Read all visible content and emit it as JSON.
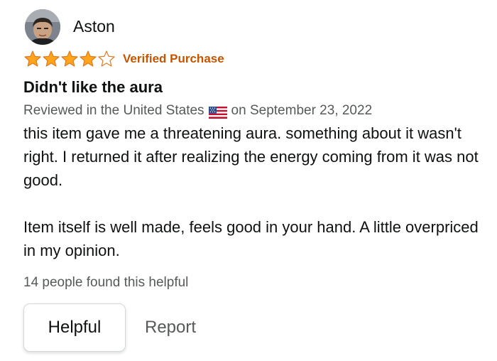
{
  "review": {
    "author": "Aston",
    "rating": 4,
    "rating_max": 5,
    "star_color": "#ffa41c",
    "verified_label": "Verified Purchase",
    "verified_color": "#c45500",
    "title": "Didn't like the aura",
    "meta_prefix": "Reviewed in the United States",
    "meta_flag_icon": "us-flag-icon",
    "meta_suffix": "on September 23, 2022",
    "body_paragraph_1": "this item gave me a threatening aura. something about it wasn't right. I returned it after realizing the energy coming from it was not good.",
    "body_paragraph_2": "Item itself is well made, feels good in your hand. A little overpriced in my opinion.",
    "helpful_count_text": "14 people found this helpful",
    "helpful_button_label": "Helpful",
    "report_label": "Report"
  }
}
